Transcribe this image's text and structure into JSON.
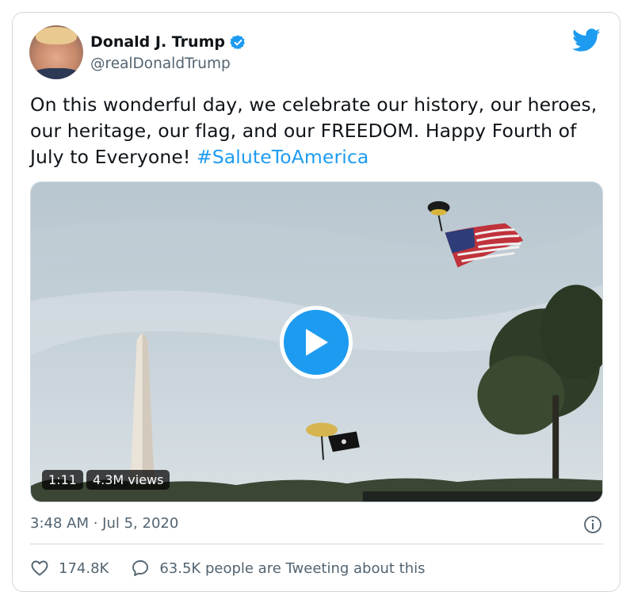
{
  "author": {
    "name": "Donald J. Trump",
    "handle": "@realDonaldTrump",
    "verified": true
  },
  "tweet": {
    "text": "On this wonderful day, we celebrate our history, our heroes, our heritage, our flag, and our FREEDOM. Happy Fourth of July to Everyone! ",
    "hashtag": "#SaluteToAmerica"
  },
  "media": {
    "duration": "1:11",
    "views": "4.3M views"
  },
  "timestamp": "3:48 AM · Jul 5, 2020",
  "actions": {
    "likes": "174.8K",
    "conversation": "63.5K people are Tweeting about this"
  },
  "colors": {
    "accent": "#1d9bf0",
    "secondary_text": "#536471",
    "border": "#cfd9de"
  },
  "icons": [
    "avatar",
    "verified-badge-icon",
    "twitter-bird-icon",
    "play-icon",
    "info-icon",
    "heart-icon",
    "reply-bubble-icon"
  ]
}
